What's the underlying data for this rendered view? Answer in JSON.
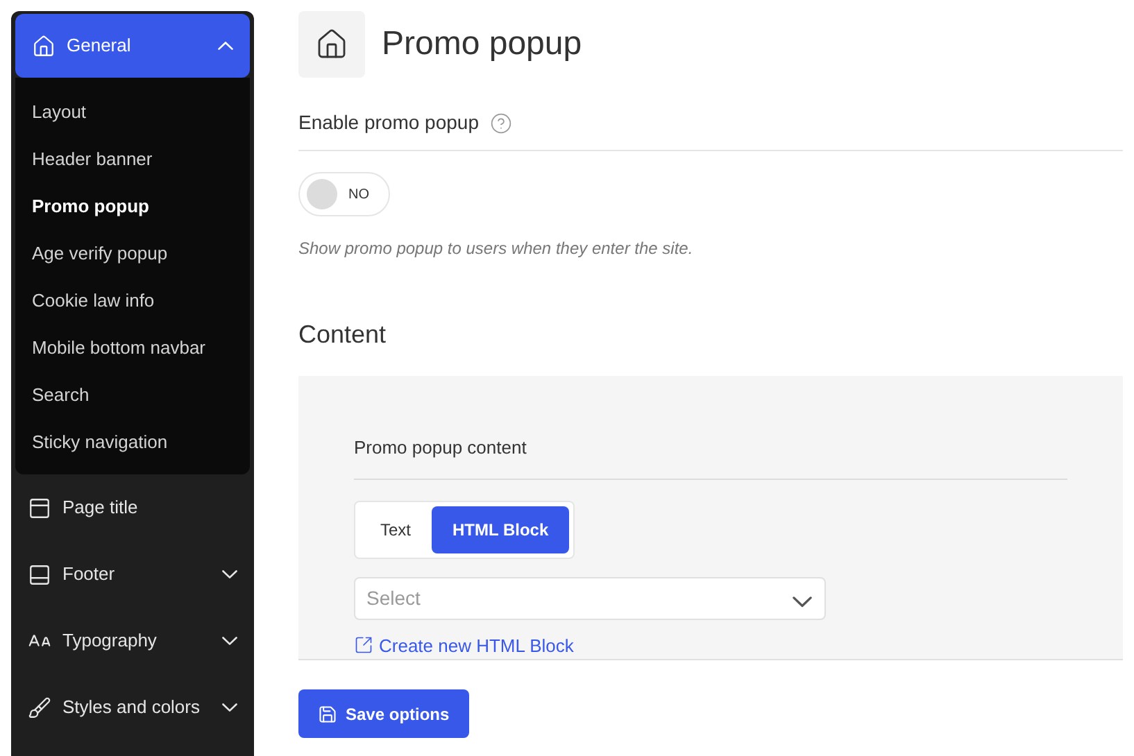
{
  "sidebar": {
    "items": [
      {
        "label": "General",
        "active": true,
        "expanded": true,
        "children": [
          {
            "label": "Layout",
            "selected": false
          },
          {
            "label": "Header banner",
            "selected": false
          },
          {
            "label": "Promo popup",
            "selected": true
          },
          {
            "label": "Age verify popup",
            "selected": false
          },
          {
            "label": "Cookie law info",
            "selected": false
          },
          {
            "label": "Mobile bottom navbar",
            "selected": false
          },
          {
            "label": "Search",
            "selected": false
          },
          {
            "label": "Sticky navigation",
            "selected": false
          }
        ]
      },
      {
        "label": "Page title",
        "active": false
      },
      {
        "label": "Footer",
        "active": false,
        "expanded": false
      },
      {
        "label": "Typography",
        "active": false,
        "expanded": false
      },
      {
        "label": "Styles and colors",
        "active": false,
        "expanded": false
      }
    ]
  },
  "page": {
    "title": "Promo popup",
    "enable": {
      "label": "Enable promo popup",
      "on": false,
      "off_text": "NO",
      "hint": "Show promo popup to users when they enter the site."
    },
    "content": {
      "heading": "Content",
      "field_label": "Promo popup content",
      "tabs": [
        {
          "label": "Text",
          "selected": false
        },
        {
          "label": "HTML Block",
          "selected": true
        }
      ],
      "select": {
        "placeholder": "Select"
      },
      "link": "Create new HTML Block"
    },
    "save": "Save options"
  }
}
